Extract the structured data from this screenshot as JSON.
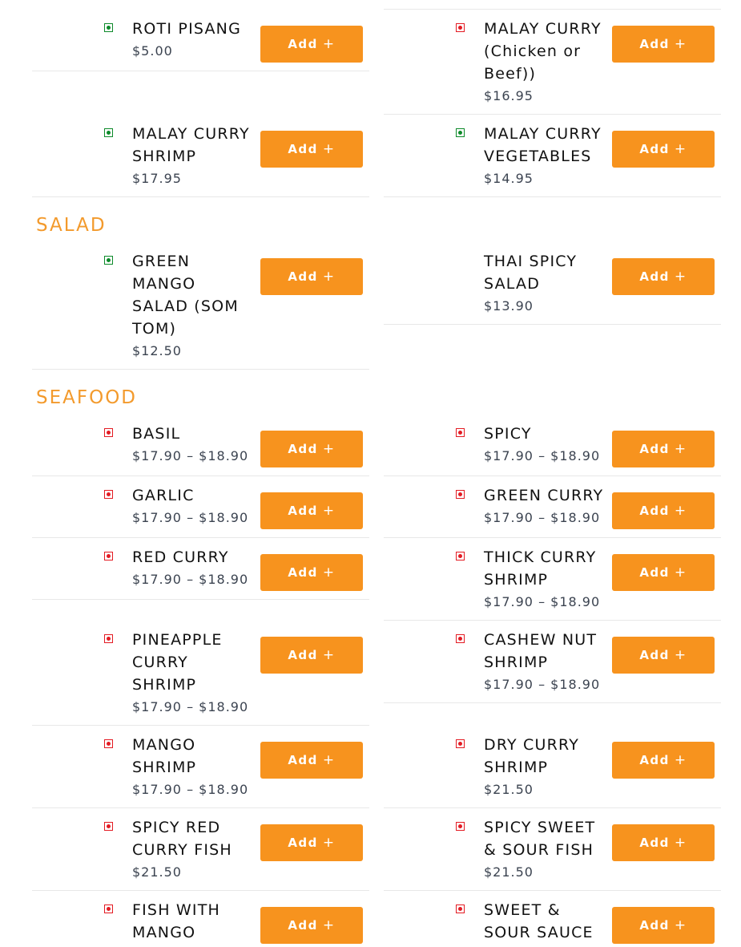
{
  "colors": {
    "accent": "#f7931e",
    "section_title": "#f39a2c",
    "veg": "#0d8a2a",
    "non_veg": "#e31b23"
  },
  "button": {
    "label": "Add",
    "icon": "plus-icon",
    "symbol": "+"
  },
  "sections": [
    {
      "title": "",
      "items": [
        {
          "name": "ROTI PISANG",
          "price": "$5.00",
          "diet": "veg"
        },
        {
          "name": "MALAY CURRY (Chicken or Beef))",
          "price": "$16.95",
          "diet": "non-veg"
        },
        {
          "name": "MALAY CURRY SHRIMP",
          "price": "$17.95",
          "diet": "veg"
        },
        {
          "name": "MALAY CURRY VEGETABLES",
          "price": "$14.95",
          "diet": "veg"
        }
      ]
    },
    {
      "title": "SALAD",
      "items": [
        {
          "name": "GREEN MANGO SALAD (SOM TOM)",
          "price": "$12.50",
          "diet": "veg"
        },
        {
          "name": "THAI SPICY SALAD",
          "price": "$13.90",
          "diet": "none"
        }
      ]
    },
    {
      "title": "SEAFOOD",
      "items": [
        {
          "name": "BASIL",
          "price": "$17.90 – $18.90",
          "diet": "non-veg"
        },
        {
          "name": "SPICY",
          "price": "$17.90 – $18.90",
          "diet": "non-veg"
        },
        {
          "name": "GARLIC",
          "price": "$17.90 – $18.90",
          "diet": "non-veg"
        },
        {
          "name": "GREEN CURRY",
          "price": "$17.90 – $18.90",
          "diet": "non-veg"
        },
        {
          "name": "RED CURRY",
          "price": "$17.90 – $18.90",
          "diet": "non-veg"
        },
        {
          "name": "THICK CURRY SHRIMP",
          "price": "$17.90 – $18.90",
          "diet": "non-veg"
        },
        {
          "name": "PINEAPPLE CURRY SHRIMP",
          "price": "$17.90 – $18.90",
          "diet": "non-veg"
        },
        {
          "name": "CASHEW NUT SHRIMP",
          "price": "$17.90 – $18.90",
          "diet": "non-veg"
        },
        {
          "name": "MANGO SHRIMP",
          "price": "$17.90 – $18.90",
          "diet": "non-veg"
        },
        {
          "name": "DRY CURRY SHRIMP",
          "price": "$21.50",
          "diet": "non-veg"
        },
        {
          "name": "SPICY RED CURRY FISH",
          "price": "$21.50",
          "diet": "non-veg"
        },
        {
          "name": "SPICY SWEET & SOUR FISH",
          "price": "$21.50",
          "diet": "non-veg"
        },
        {
          "name": "FISH WITH MANGO",
          "price": "",
          "diet": "non-veg"
        },
        {
          "name": "SWEET & SOUR SAUCE",
          "price": "",
          "diet": "non-veg"
        }
      ]
    }
  ]
}
